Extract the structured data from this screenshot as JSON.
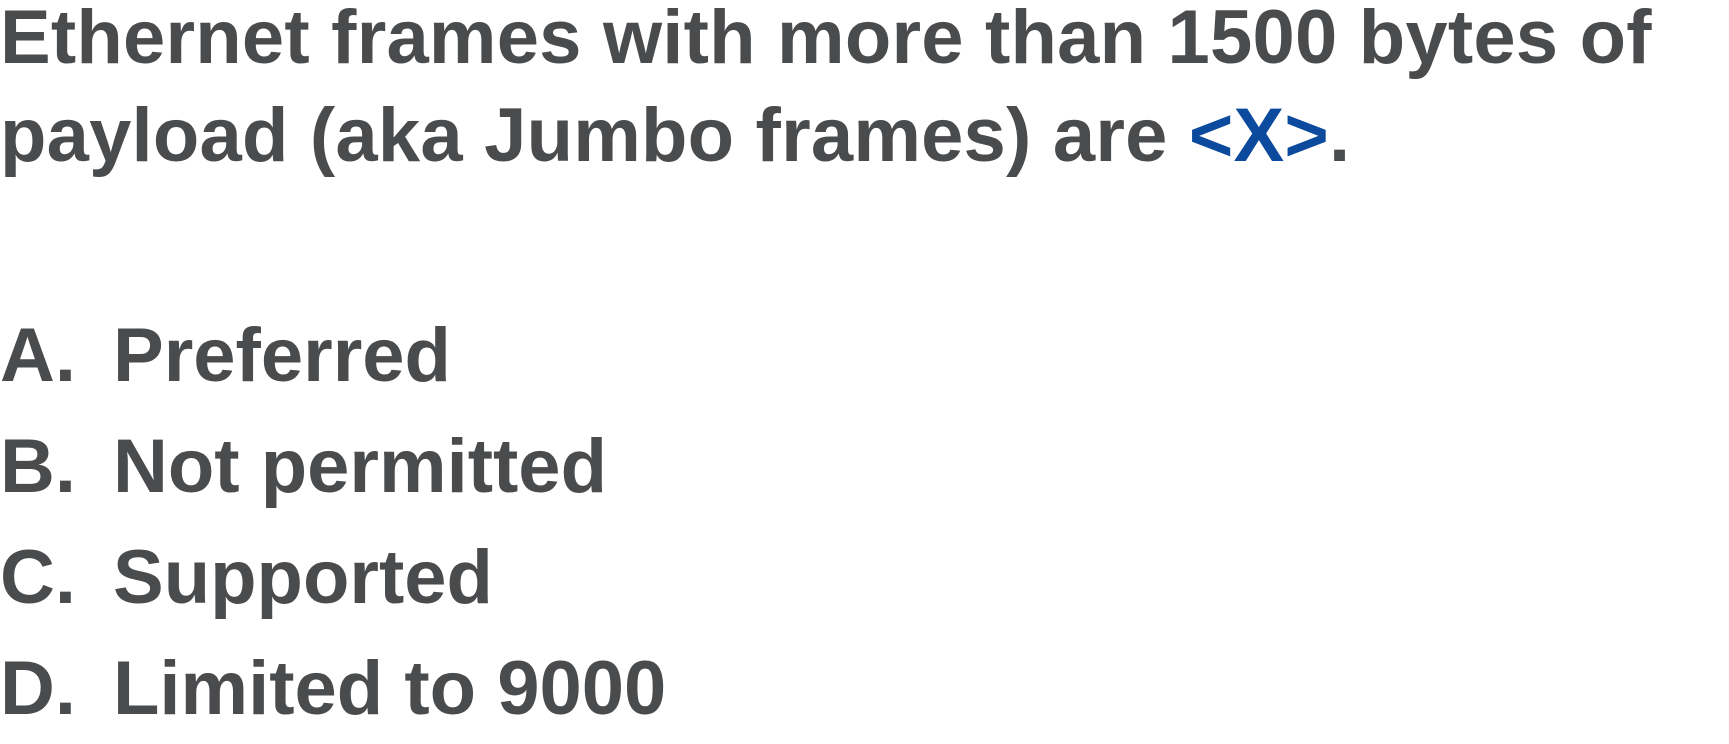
{
  "question": {
    "text_before": "Ethernet frames with more than 1500 bytes of payload (aka Jumbo frames) are ",
    "blank": "<X>",
    "text_after": ".",
    "colors": {
      "text": "#4a4b4d",
      "blank": "#0b4a9c"
    }
  },
  "options": [
    {
      "letter": "A.",
      "text": "Preferred"
    },
    {
      "letter": "B.",
      "text": "Not permitted"
    },
    {
      "letter": "C.",
      "text": "Supported"
    },
    {
      "letter": "D.",
      "text": "Limited to 9000"
    }
  ]
}
